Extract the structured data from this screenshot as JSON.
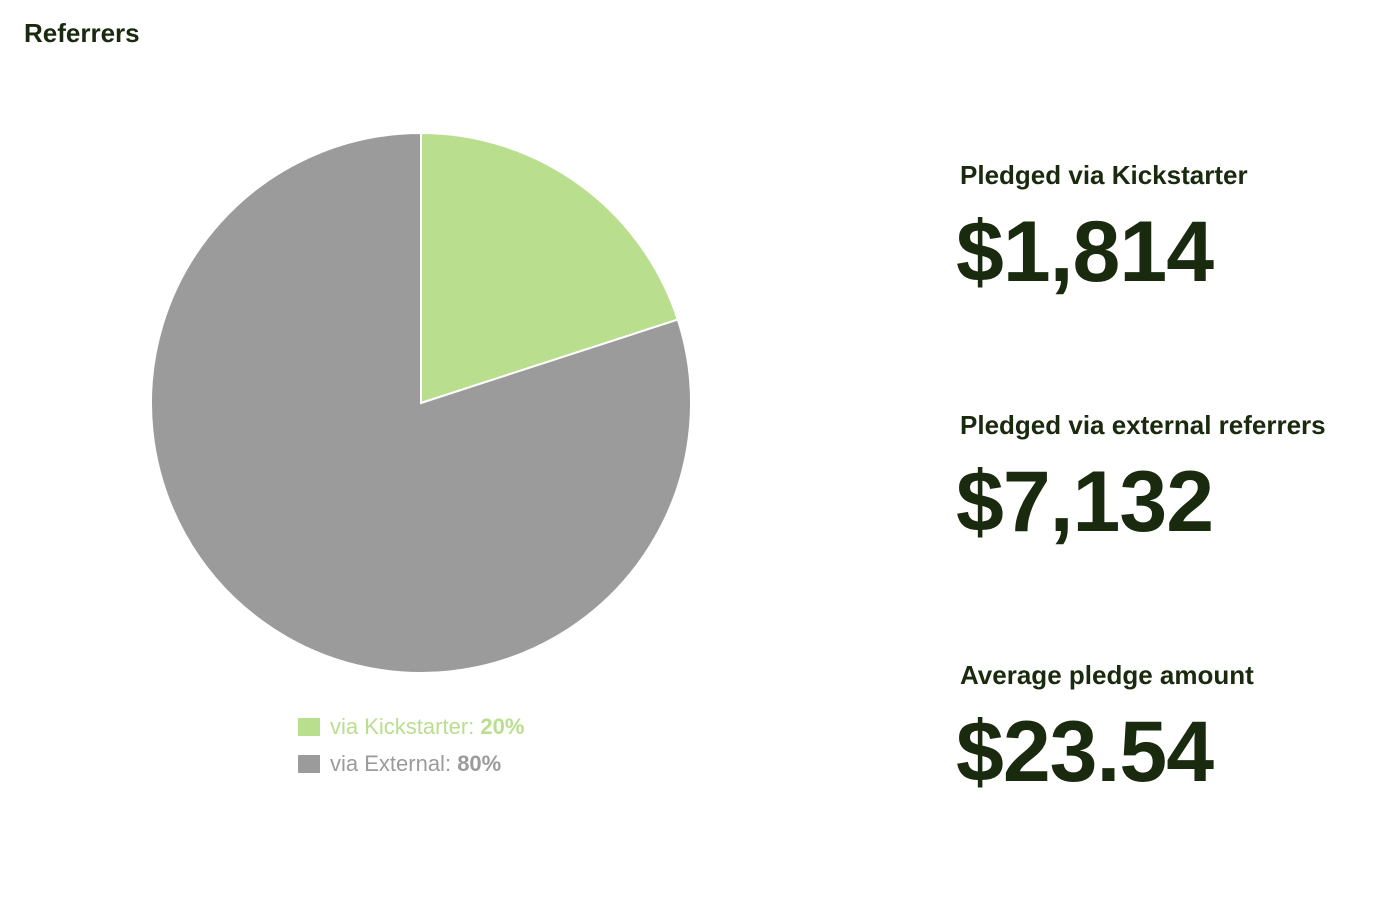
{
  "header": {
    "title": "Referrers"
  },
  "chart_data": {
    "type": "pie",
    "categories": [
      "via Kickstarter",
      "via External"
    ],
    "values": [
      20,
      80
    ],
    "colors": [
      "#b8de8e",
      "#9b9b9b"
    ],
    "legend": [
      {
        "label": "via Kickstarter:",
        "value": "20%",
        "color": "#b8de8e"
      },
      {
        "label": "via External:",
        "value": "80%",
        "color": "#9b9b9b"
      }
    ],
    "legend_position": "bottom"
  },
  "stats": [
    {
      "label": "Pledged via Kickstarter",
      "value": "$1,814"
    },
    {
      "label": "Pledged via external referrers",
      "value": "$7,132"
    },
    {
      "label": "Average pledge amount",
      "value": "$23.54"
    }
  ]
}
